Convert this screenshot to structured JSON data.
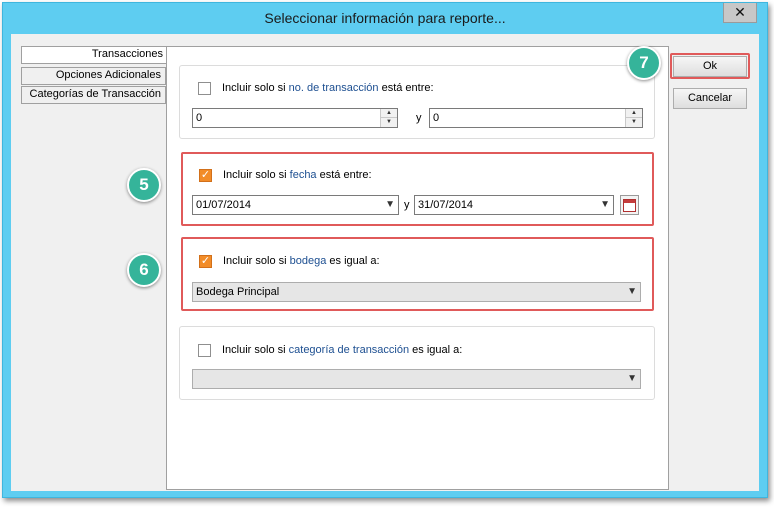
{
  "window": {
    "title": "Seleccionar información para reporte...",
    "close_glyph": "✕"
  },
  "tabs": [
    "Transacciones",
    "Opciones Adicionales",
    "Categorías de Transacción"
  ],
  "filters": {
    "transaction_number": {
      "checked": false,
      "prefix": "Incluir solo si ",
      "keyword": "no. de transacción",
      "suffix": " está entre:",
      "from": "0",
      "conjunction": "y",
      "to": "0"
    },
    "date": {
      "checked": true,
      "prefix": "Incluir solo si ",
      "keyword": "fecha",
      "suffix": " está entre:",
      "from": "01/07/2014",
      "conjunction": "y",
      "to": "31/07/2014"
    },
    "warehouse": {
      "checked": true,
      "prefix": "Incluir solo si ",
      "keyword": "bodega",
      "suffix": " es igual a:",
      "value": "Bodega Principal"
    },
    "category": {
      "checked": false,
      "prefix": "Incluir solo si ",
      "keyword": "categoría de transacción",
      "suffix": " es igual a:",
      "value": ""
    }
  },
  "buttons": {
    "ok": "Ok",
    "cancel": "Cancelar"
  },
  "callouts": [
    "5",
    "6",
    "7"
  ],
  "icons": {
    "close": "close-icon",
    "calendar": "calendar-icon",
    "dropdown": "chevron-down-icon",
    "check": "check-icon",
    "spin": "spin-arrows-icon"
  },
  "colors": {
    "title_bar": "#5ecdf1",
    "highlight": "#e05a5a",
    "badge": "#35b49a",
    "checkbox": "#f28c28",
    "keyword": "#1d4f91"
  }
}
